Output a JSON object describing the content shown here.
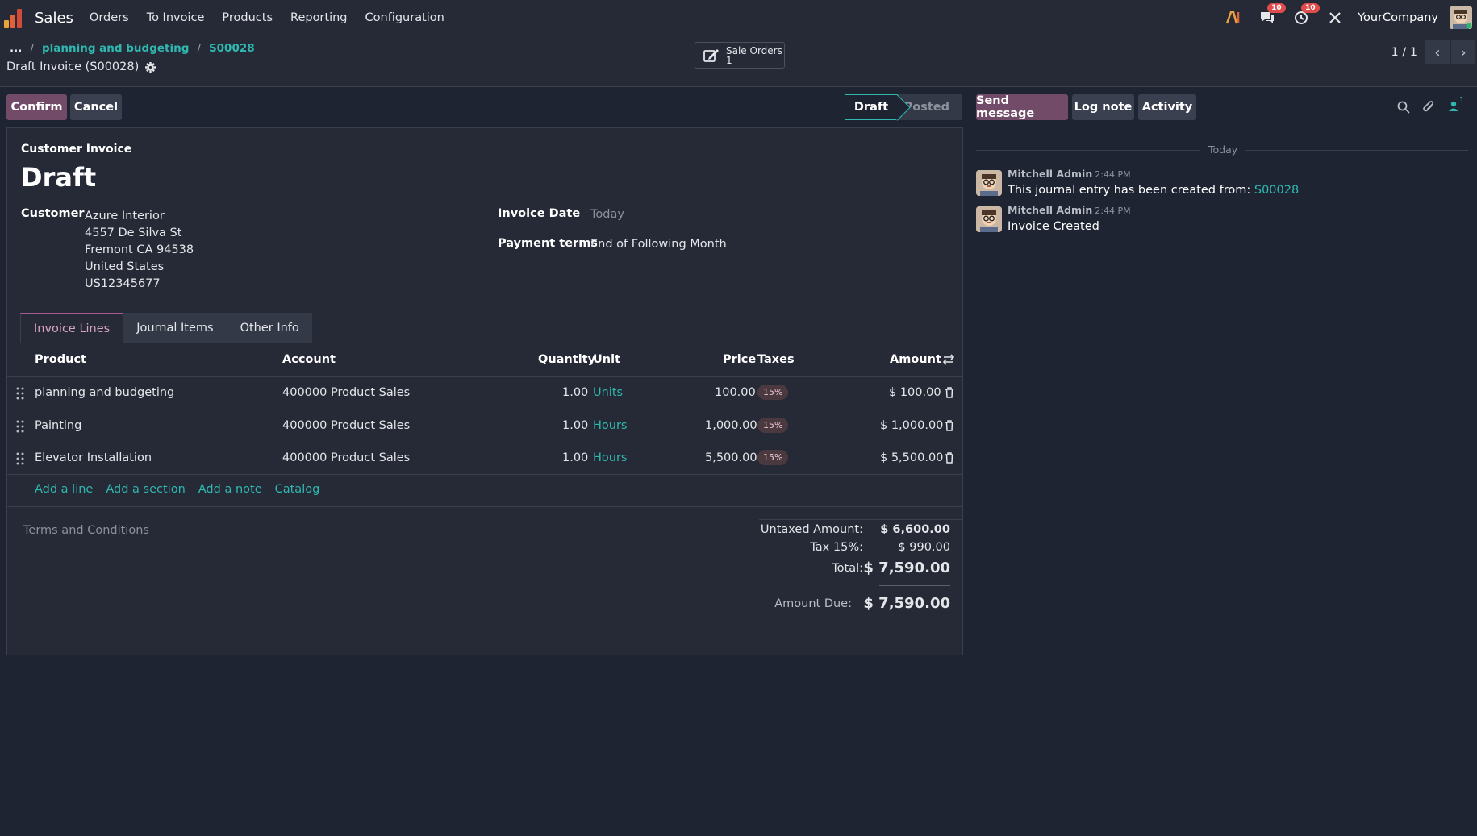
{
  "nav": {
    "app_name": "Sales",
    "menu": [
      "Orders",
      "To Invoice",
      "Products",
      "Reporting",
      "Configuration"
    ],
    "messages_badge": "10",
    "activities_badge": "10",
    "company": "YourCompany",
    "brand_color": "#714b67",
    "accent_color": "#2fb8b0"
  },
  "breadcrumb": {
    "ellipsis": "...",
    "items": [
      "planning and budgeting",
      "S00028"
    ],
    "separator": "/"
  },
  "record": {
    "title": "Draft Invoice (S00028)"
  },
  "smart_button": {
    "label": "Sale Orders",
    "count": "1"
  },
  "pager": {
    "value": "1 / 1"
  },
  "actions": {
    "confirm": "Confirm",
    "cancel": "Cancel"
  },
  "status": {
    "draft": "Draft",
    "posted": "Posted",
    "current": "Draft"
  },
  "chatter_actions": {
    "send_message": "Send message",
    "log_note": "Log note",
    "activity": "Activity",
    "followers_count": "1"
  },
  "form": {
    "subtitle": "Customer Invoice",
    "title": "Draft",
    "customer_label": "Customer",
    "customer_name": "Azure Interior",
    "address": [
      "4557 De Silva St",
      "Fremont CA 94538",
      "United States",
      "US12345677"
    ],
    "invoice_date_label": "Invoice Date",
    "invoice_date_placeholder": "Today",
    "payment_terms_label": "Payment terms",
    "payment_terms_value": "End of Following Month"
  },
  "tabs": [
    "Invoice Lines",
    "Journal Items",
    "Other Info"
  ],
  "table": {
    "headers": {
      "product": "Product",
      "account": "Account",
      "quantity": "Quantity",
      "unit": "Unit",
      "price": "Price",
      "taxes": "Taxes",
      "amount": "Amount"
    },
    "rows": [
      {
        "product": "planning and budgeting",
        "account": "400000 Product Sales",
        "quantity": "1.00",
        "unit": "Units",
        "price": "100.00",
        "tax": "15%",
        "amount": "$ 100.00"
      },
      {
        "product": "Painting",
        "account": "400000 Product Sales",
        "quantity": "1.00",
        "unit": "Hours",
        "price": "1,000.00",
        "tax": "15%",
        "amount": "$ 1,000.00"
      },
      {
        "product": "Elevator Installation",
        "account": "400000 Product Sales",
        "quantity": "1.00",
        "unit": "Hours",
        "price": "5,500.00",
        "tax": "15%",
        "amount": "$ 5,500.00"
      }
    ],
    "add_links": [
      "Add a line",
      "Add a section",
      "Add a note",
      "Catalog"
    ]
  },
  "terms_placeholder": "Terms and Conditions",
  "totals": {
    "untaxed_label": "Untaxed Amount:",
    "untaxed_value": "$ 6,600.00",
    "tax_label": "Tax 15%:",
    "tax_value": "$ 990.00",
    "total_label": "Total:",
    "total_value": "$ 7,590.00",
    "due_label": "Amount Due:",
    "due_value": "$ 7,590.00"
  },
  "chatter": {
    "date_separator": "Today",
    "messages": [
      {
        "author": "Mitchell Admin",
        "time": "2:44 PM",
        "body": "This journal entry has been created from:",
        "link": "S00028"
      },
      {
        "author": "Mitchell Admin",
        "time": "2:44 PM",
        "body": "Invoice Created"
      }
    ]
  }
}
